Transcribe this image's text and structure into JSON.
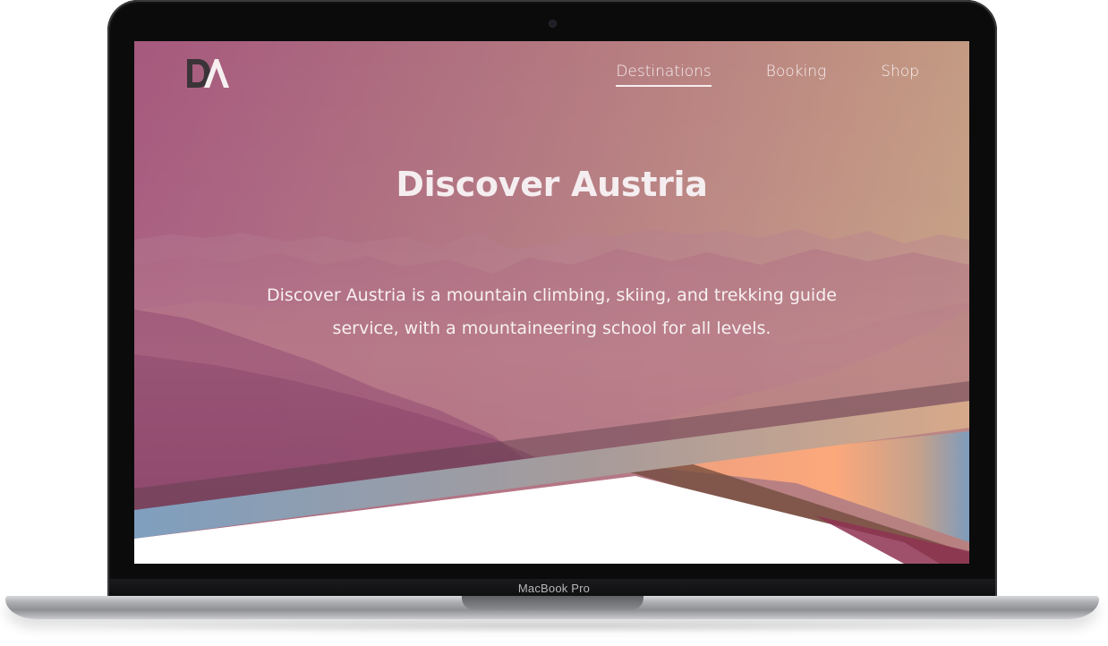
{
  "device": {
    "label": "MacBook Pro"
  },
  "site": {
    "logo_text": "DA",
    "nav": [
      {
        "label": "Destinations",
        "active": true
      },
      {
        "label": "Booking",
        "active": false
      },
      {
        "label": "Shop",
        "active": false
      }
    ],
    "hero": {
      "title": "Discover Austria",
      "description": "Discover Austria is a mountain climbing, skiing, and trekking guide service, with a mountaineering school for all levels."
    }
  },
  "colors": {
    "hero_gradient_start": "#a6597e",
    "hero_gradient_end": "#c7a383",
    "ribbon_blue": "#7f9fbf",
    "ribbon_peach": "#f2a17a",
    "ribbon_brown": "#7a5a3c"
  }
}
